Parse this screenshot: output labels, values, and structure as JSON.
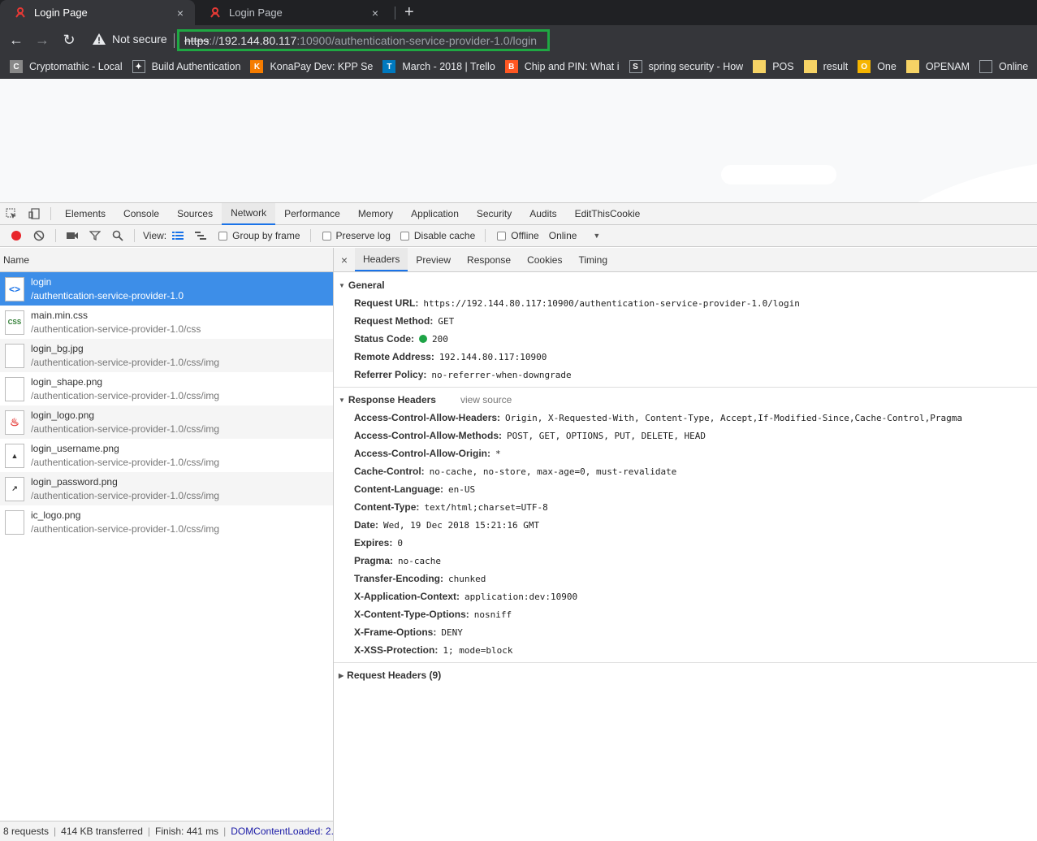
{
  "tabs": [
    {
      "title": "Login Page",
      "close": "×"
    },
    {
      "title": "Login Page",
      "close": "×"
    }
  ],
  "newtab": "+",
  "toolbar": {
    "back": "←",
    "forward": "→",
    "reload": "↻",
    "security": "Not secure",
    "url_scheme": "https",
    "url_sep": "://",
    "url_host": "192.144.80.117",
    "url_rest": ":10900/authentication-service-provider-1.0/login"
  },
  "bookmarks": [
    {
      "label": "Cryptomathic - Local",
      "icon": "C",
      "color": "#888888"
    },
    {
      "label": "Build Authentication",
      "icon": "✦",
      "color": "#35363a"
    },
    {
      "label": "KonaPay Dev: KPP Se",
      "icon": "K",
      "color": "#f57c00"
    },
    {
      "label": "March - 2018 | Trello",
      "icon": "T",
      "color": "#0079bf"
    },
    {
      "label": "Chip and PIN: What i",
      "icon": "B",
      "color": "#ff5722"
    },
    {
      "label": "spring security - How",
      "icon": "S",
      "color": "#35363a"
    },
    {
      "label": "POS",
      "icon": "",
      "color": "#f6d365"
    },
    {
      "label": "result",
      "icon": "",
      "color": "#f6d365"
    },
    {
      "label": "One",
      "icon": "O",
      "color": "#f6b500"
    },
    {
      "label": "OPENAM",
      "icon": "",
      "color": "#f6d365"
    },
    {
      "label": "Online",
      "icon": "",
      "color": "#35363a"
    }
  ],
  "devtools_tabs": [
    "Elements",
    "Console",
    "Sources",
    "Network",
    "Performance",
    "Memory",
    "Application",
    "Security",
    "Audits",
    "EditThisCookie"
  ],
  "devtools_selected": "Network",
  "network_toolbar": {
    "view_label": "View:",
    "group_by_frame": "Group by frame",
    "preserve_log": "Preserve log",
    "disable_cache": "Disable cache",
    "offline": "Offline",
    "throttle": "Online",
    "throttle_arrow": "▼"
  },
  "list_header": "Name",
  "requests": [
    {
      "name": "login",
      "path": "/authentication-service-provider-1.0",
      "icon": "<>"
    },
    {
      "name": "main.min.css",
      "path": "/authentication-service-provider-1.0/css",
      "icon": "CSS"
    },
    {
      "name": "login_bg.jpg",
      "path": "/authentication-service-provider-1.0/css/img",
      "icon": ""
    },
    {
      "name": "login_shape.png",
      "path": "/authentication-service-provider-1.0/css/img",
      "icon": ""
    },
    {
      "name": "login_logo.png",
      "path": "/authentication-service-provider-1.0/css/img",
      "icon": "♨"
    },
    {
      "name": "login_username.png",
      "path": "/authentication-service-provider-1.0/css/img",
      "icon": "▲"
    },
    {
      "name": "login_password.png",
      "path": "/authentication-service-provider-1.0/css/img",
      "icon": "↗"
    },
    {
      "name": "ic_logo.png",
      "path": "/authentication-service-provider-1.0/css/img",
      "icon": ""
    }
  ],
  "status": {
    "requests": "8 requests",
    "transferred": "414 KB transferred",
    "finish": "Finish: 441 ms",
    "dcl": "DOMContentLoaded: 2...",
    "sep": "|"
  },
  "detail_close": "×",
  "detail_tabs": [
    "Headers",
    "Preview",
    "Response",
    "Cookies",
    "Timing"
  ],
  "detail_selected": "Headers",
  "general": {
    "title": "General",
    "rows": [
      {
        "k": "Request URL:",
        "v": "https://192.144.80.117:10900/authentication-service-provider-1.0/login"
      },
      {
        "k": "Request Method:",
        "v": "GET"
      },
      {
        "k": "Status Code:",
        "v": "200"
      },
      {
        "k": "Remote Address:",
        "v": "192.144.80.117:10900"
      },
      {
        "k": "Referrer Policy:",
        "v": "no-referrer-when-downgrade"
      }
    ]
  },
  "response_headers": {
    "title": "Response Headers",
    "view_source": "view source",
    "rows": [
      {
        "k": "Access-Control-Allow-Headers:",
        "v": "Origin, X-Requested-With, Content-Type, Accept,If-Modified-Since,Cache-Control,Pragma"
      },
      {
        "k": "Access-Control-Allow-Methods:",
        "v": "POST, GET, OPTIONS, PUT, DELETE, HEAD"
      },
      {
        "k": "Access-Control-Allow-Origin:",
        "v": "*"
      },
      {
        "k": "Cache-Control:",
        "v": "no-cache, no-store, max-age=0, must-revalidate"
      },
      {
        "k": "Content-Language:",
        "v": "en-US"
      },
      {
        "k": "Content-Type:",
        "v": "text/html;charset=UTF-8"
      },
      {
        "k": "Date:",
        "v": "Wed, 19 Dec 2018 15:21:16 GMT"
      },
      {
        "k": "Expires:",
        "v": "0"
      },
      {
        "k": "Pragma:",
        "v": "no-cache"
      },
      {
        "k": "Transfer-Encoding:",
        "v": "chunked"
      },
      {
        "k": "X-Application-Context:",
        "v": "application:dev:10900"
      },
      {
        "k": "X-Content-Type-Options:",
        "v": "nosniff"
      },
      {
        "k": "X-Frame-Options:",
        "v": "DENY"
      },
      {
        "k": "X-XSS-Protection:",
        "v": "1; mode=block"
      }
    ]
  },
  "request_headers": {
    "title": "Request Headers (9)"
  },
  "colors": {
    "highlight_border": "#1fa843",
    "selected_row": "#3d8ee8",
    "status_ok": "#1ea446"
  }
}
